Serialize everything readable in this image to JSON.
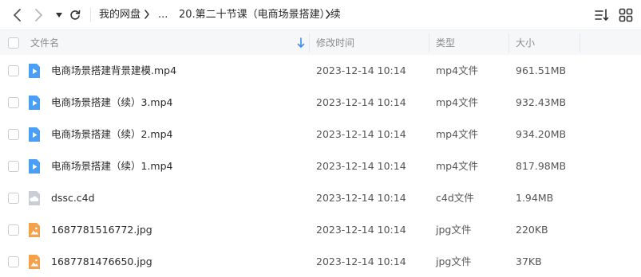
{
  "breadcrumb": {
    "root": "我的网盘",
    "ellipsis": "...",
    "current": "20.第二十节课（电商场景搭建）续"
  },
  "columns": {
    "name": "文件名",
    "modified": "修改时间",
    "type": "类型",
    "size": "大小"
  },
  "files": [
    {
      "name": "电商场景搭建背景建模.mp4",
      "modified": "2023-12-14 10:14",
      "type": "mp4文件",
      "size": "961.51MB",
      "icon": "video-file-icon"
    },
    {
      "name": "电商场景搭建（续）3.mp4",
      "modified": "2023-12-14 10:14",
      "type": "mp4文件",
      "size": "932.43MB",
      "icon": "video-file-icon"
    },
    {
      "name": "电商场景搭建（续）2.mp4",
      "modified": "2023-12-14 10:14",
      "type": "mp4文件",
      "size": "934.20MB",
      "icon": "video-file-icon"
    },
    {
      "name": "电商场景搭建（续）1.mp4",
      "modified": "2023-12-14 10:14",
      "type": "mp4文件",
      "size": "817.98MB",
      "icon": "video-file-icon"
    },
    {
      "name": "dssc.c4d",
      "modified": "2023-12-14 10:14",
      "type": "c4d文件",
      "size": "1.94MB",
      "icon": "cloud-file-icon"
    },
    {
      "name": "1687781516772.jpg",
      "modified": "2023-12-14 10:14",
      "type": "jpg文件",
      "size": "220KB",
      "icon": "image-file-icon"
    },
    {
      "name": "1687781476650.jpg",
      "modified": "2023-12-14 10:14",
      "type": "jpg文件",
      "size": "37KB",
      "icon": "image-file-icon"
    }
  ],
  "colors": {
    "video_icon": "#4a9ff5",
    "image_icon": "#f5a14a",
    "cloud_icon": "#c9ced6",
    "sort_arrow": "#3b8cf0"
  }
}
